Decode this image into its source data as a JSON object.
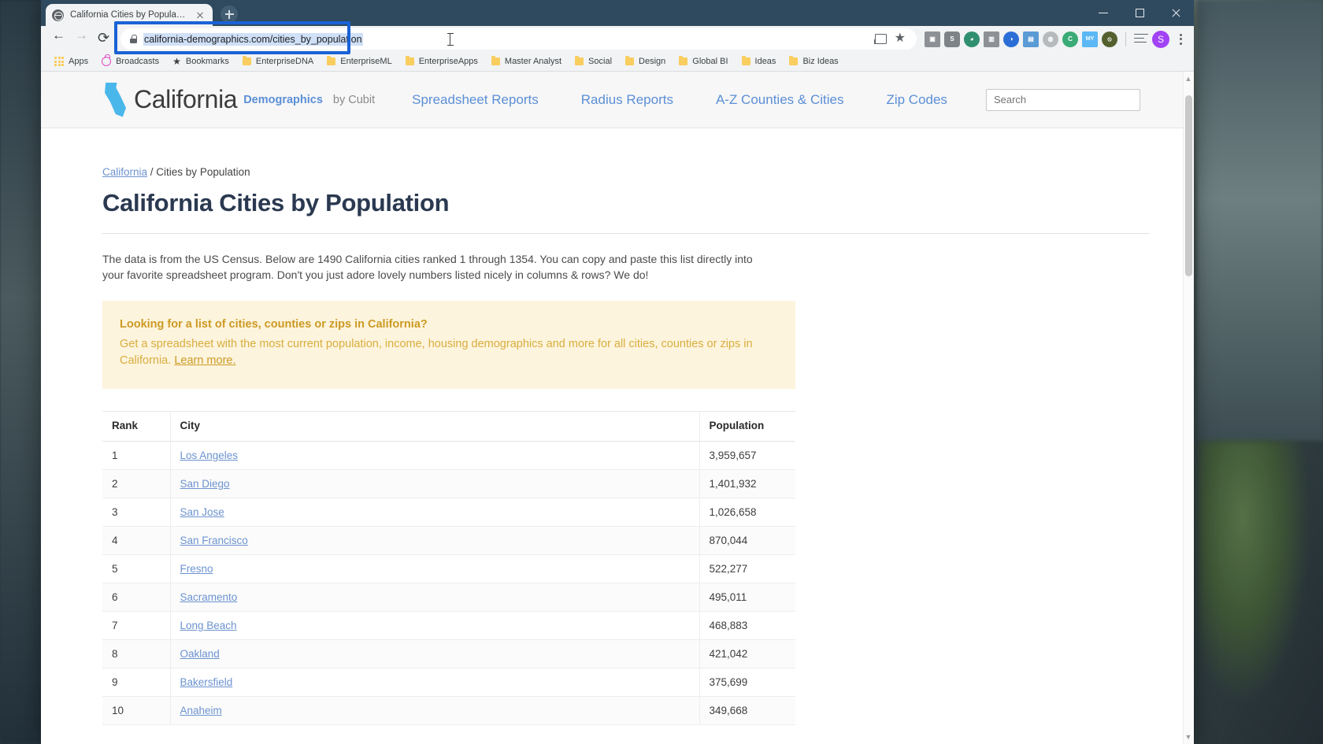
{
  "browser": {
    "tab": {
      "title": "California Cities by Population",
      "favicon": "globe-icon",
      "close": "×"
    },
    "new_tab_label": "+",
    "window_controls": {
      "minimize": "minimize-icon",
      "maximize": "maximize-icon",
      "close": "close-icon"
    },
    "nav": {
      "back": "back-arrow-icon",
      "forward": "forward-arrow-icon",
      "reload": "reload-icon"
    },
    "omnibox": {
      "url": "california-demographics.com/cities_by_population",
      "lock": "lock-icon",
      "selected": true,
      "focus_ring_color": "#1a62d6",
      "selection_color": "#cfe0f7",
      "cast": "cast-icon",
      "bookmark_star": "★"
    },
    "extensions": [
      {
        "name": "screenshot-extension",
        "glyph": "▣",
        "color": "#8d9094"
      },
      {
        "name": "skype-extension",
        "glyph": "S",
        "color": "#7d8488"
      },
      {
        "name": "phone-extension",
        "glyph": "◕",
        "color": "#2f8f6e"
      },
      {
        "name": "columns-extension",
        "glyph": "▥",
        "color": "#8d9094"
      },
      {
        "name": "moon-extension",
        "glyph": "◕",
        "color": "#2b6ed6"
      },
      {
        "name": "blue-square-extension",
        "glyph": "▤",
        "color": "#5b9bd5"
      },
      {
        "name": "grey-circle-extension",
        "glyph": "◍",
        "color": "#b6babd"
      },
      {
        "name": "green-circle-extension",
        "glyph": "G",
        "color": "#3aab76"
      },
      {
        "name": "my-extension",
        "glyph": "MY",
        "color": "#5bb8f5"
      },
      {
        "name": "block-extension",
        "glyph": "⦸",
        "color": "#55602f"
      }
    ],
    "reading_list_icon": "reading-list-icon",
    "profile": {
      "initial": "S",
      "color": "#a142f4"
    },
    "menu_icon": "kebab-menu-icon",
    "bookmarks": [
      {
        "label": "Apps",
        "icon": "apps-grid-icon"
      },
      {
        "label": "Broadcasts",
        "icon": "broadcast-icon"
      },
      {
        "label": "Bookmarks",
        "icon": "star-icon"
      },
      {
        "label": "EnterpriseDNA",
        "icon": "folder-icon"
      },
      {
        "label": "EnterpriseML",
        "icon": "folder-icon"
      },
      {
        "label": "EnterpriseApps",
        "icon": "folder-icon"
      },
      {
        "label": "Master Analyst",
        "icon": "folder-icon"
      },
      {
        "label": "Social",
        "icon": "folder-icon"
      },
      {
        "label": "Design",
        "icon": "folder-icon"
      },
      {
        "label": "Global BI",
        "icon": "folder-icon"
      },
      {
        "label": "Ideas",
        "icon": "folder-icon"
      },
      {
        "label": "Biz Ideas",
        "icon": "folder-icon"
      }
    ]
  },
  "site": {
    "logo": {
      "main": "California",
      "sub": "Demographics",
      "by": "by Cubit",
      "shape": "california-state-icon"
    },
    "nav": [
      {
        "label": "Spreadsheet Reports"
      },
      {
        "label": "Radius Reports"
      },
      {
        "label": "A-Z Counties & Cities"
      },
      {
        "label": "Zip Codes"
      }
    ],
    "search": {
      "placeholder": "Search",
      "value": ""
    }
  },
  "page": {
    "breadcrumb": {
      "root": "California",
      "separator": "/",
      "current": "Cities by Population"
    },
    "title": "California Cities by Population",
    "intro": "The data is from the US Census. Below are 1490 California cities ranked 1 through 1354. You can copy and paste this list directly into your favorite spreadsheet program. Don't you just adore lovely numbers listed nicely in columns & rows? We do!",
    "callout": {
      "title": "Looking for a list of cities, counties or zips in California?",
      "body": "Get a spreadsheet with the most current population, income, housing demographics and more for all cities, counties or zips in California.",
      "link": "Learn more."
    },
    "table": {
      "columns": [
        "Rank",
        "City",
        "Population"
      ],
      "rows": [
        {
          "rank": "1",
          "city": "Los Angeles",
          "population": "3,959,657"
        },
        {
          "rank": "2",
          "city": "San Diego",
          "population": "1,401,932"
        },
        {
          "rank": "3",
          "city": "San Jose",
          "population": "1,026,658"
        },
        {
          "rank": "4",
          "city": "San Francisco",
          "population": "870,044"
        },
        {
          "rank": "5",
          "city": "Fresno",
          "population": "522,277"
        },
        {
          "rank": "6",
          "city": "Sacramento",
          "population": "495,011"
        },
        {
          "rank": "7",
          "city": "Long Beach",
          "population": "468,883"
        },
        {
          "rank": "8",
          "city": "Oakland",
          "population": "421,042"
        },
        {
          "rank": "9",
          "city": "Bakersfield",
          "population": "375,699"
        },
        {
          "rank": "10",
          "city": "Anaheim",
          "population": "349,668"
        }
      ]
    }
  }
}
